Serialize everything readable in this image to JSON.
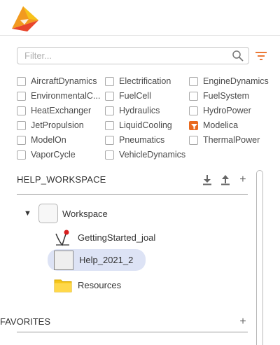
{
  "filter": {
    "placeholder": "Filter..."
  },
  "libraries": [
    {
      "label": "AircraftDynamics",
      "checked": false
    },
    {
      "label": "Electrification",
      "checked": false
    },
    {
      "label": "EngineDynamics",
      "checked": false
    },
    {
      "label": "EnvironmentalC...",
      "checked": false
    },
    {
      "label": "FuelCell",
      "checked": false
    },
    {
      "label": "FuelSystem",
      "checked": false
    },
    {
      "label": "HeatExchanger",
      "checked": false
    },
    {
      "label": "Hydraulics",
      "checked": false
    },
    {
      "label": "HydroPower",
      "checked": false
    },
    {
      "label": "JetPropulsion",
      "checked": false
    },
    {
      "label": "LiquidCooling",
      "checked": false
    },
    {
      "label": "Modelica",
      "checked": true
    },
    {
      "label": "ModelOn",
      "checked": false
    },
    {
      "label": "Pneumatics",
      "checked": false
    },
    {
      "label": "ThermalPower",
      "checked": false
    },
    {
      "label": "VaporCycle",
      "checked": false
    },
    {
      "label": "VehicleDynamics",
      "checked": false
    }
  ],
  "workspace_section": {
    "title": "HELP_WORKSPACE",
    "add_symbol": "+",
    "tree": {
      "root_label": "Workspace",
      "expander": "▼",
      "children": [
        {
          "label": "GettingStarted_joal",
          "icon": "model-icon"
        },
        {
          "label": "Help_2021_2",
          "icon": "package-icon",
          "selected": true
        },
        {
          "label": "Resources",
          "icon": "folder-icon"
        }
      ]
    }
  },
  "favorites_section": {
    "title": "FAVORITES",
    "add_symbol": "+"
  },
  "colors": {
    "accent": "#e96a1f",
    "selection": "#dde3f5",
    "folder": "#f5c518"
  }
}
